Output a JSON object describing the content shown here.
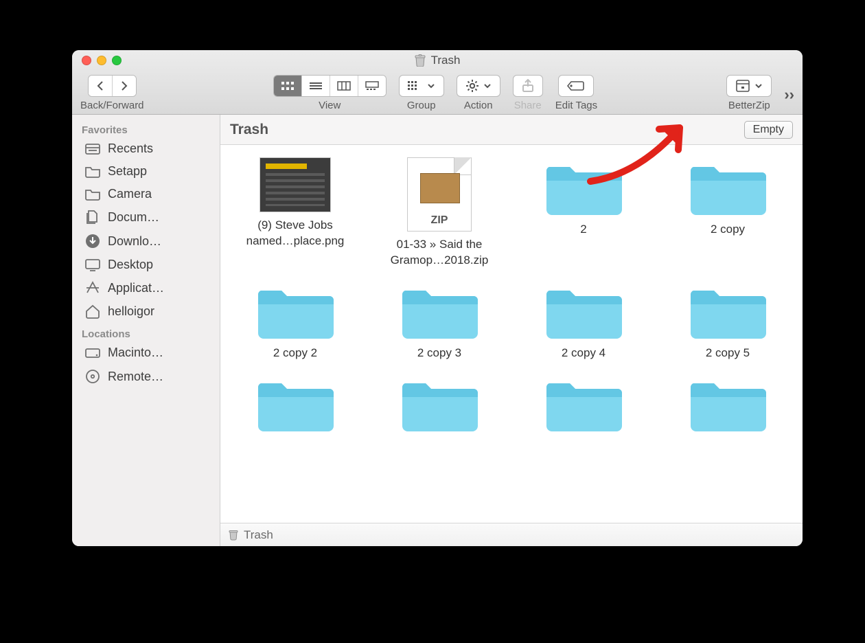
{
  "window": {
    "title": "Trash"
  },
  "toolbar": {
    "back_forward_label": "Back/Forward",
    "view_label": "View",
    "group_label": "Group",
    "action_label": "Action",
    "share_label": "Share",
    "edit_tags_label": "Edit Tags",
    "betterzip_label": "BetterZip"
  },
  "sidebar": {
    "sections": [
      {
        "header": "Favorites",
        "items": [
          {
            "icon": "recents-icon",
            "label": "Recents"
          },
          {
            "icon": "folder-icon",
            "label": "Setapp"
          },
          {
            "icon": "folder-icon",
            "label": "Camera"
          },
          {
            "icon": "documents-icon",
            "label": "Docum…"
          },
          {
            "icon": "downloads-icon",
            "label": "Downlo…"
          },
          {
            "icon": "desktop-icon",
            "label": "Desktop"
          },
          {
            "icon": "applications-icon",
            "label": "Applicat…"
          },
          {
            "icon": "home-icon",
            "label": "helloigor"
          }
        ]
      },
      {
        "header": "Locations",
        "items": [
          {
            "icon": "hdd-icon",
            "label": "Macinto…"
          },
          {
            "icon": "disc-icon",
            "label": "Remote…"
          }
        ]
      }
    ]
  },
  "location": {
    "title": "Trash",
    "empty_button": "Empty"
  },
  "files": [
    {
      "kind": "image",
      "label_line1": "(9) Steve Jobs",
      "label_line2": "named…place.png"
    },
    {
      "kind": "zip",
      "label_line1": "01-33 » Said the",
      "label_line2": "Gramop…2018.zip",
      "zip_badge": "ZIP"
    },
    {
      "kind": "folder",
      "label_line1": "2",
      "label_line2": ""
    },
    {
      "kind": "folder",
      "label_line1": "2 copy",
      "label_line2": ""
    },
    {
      "kind": "folder",
      "label_line1": "2 copy 2",
      "label_line2": ""
    },
    {
      "kind": "folder",
      "label_line1": "2 copy 3",
      "label_line2": ""
    },
    {
      "kind": "folder",
      "label_line1": "2 copy 4",
      "label_line2": ""
    },
    {
      "kind": "folder",
      "label_line1": "2 copy 5",
      "label_line2": ""
    },
    {
      "kind": "folder",
      "label_line1": "",
      "label_line2": ""
    },
    {
      "kind": "folder",
      "label_line1": "",
      "label_line2": ""
    },
    {
      "kind": "folder",
      "label_line1": "",
      "label_line2": ""
    },
    {
      "kind": "folder",
      "label_line1": "",
      "label_line2": ""
    }
  ],
  "pathbar": {
    "label": "Trash"
  },
  "annotation": {
    "kind": "arrow",
    "color": "#e1231a",
    "points_to": "empty-button"
  }
}
